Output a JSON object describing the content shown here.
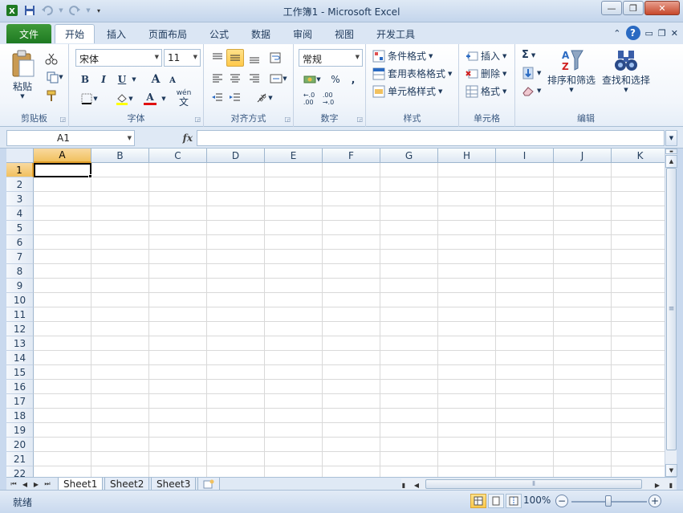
{
  "window": {
    "title": "工作簿1 - Microsoft Excel",
    "minimize": "—",
    "restore": "❐",
    "close": "✕"
  },
  "tabs": {
    "file": "文件",
    "items": [
      "开始",
      "插入",
      "页面布局",
      "公式",
      "数据",
      "审阅",
      "视图",
      "开发工具"
    ],
    "active_index": 0
  },
  "ribbon": {
    "clipboard": {
      "label": "剪贴板",
      "paste": "粘贴"
    },
    "font": {
      "label": "字体",
      "font_name": "宋体",
      "font_size": "11",
      "bold": "B",
      "italic": "I",
      "underline": "U",
      "grow": "A",
      "shrink": "A",
      "font_color": "A",
      "wen": "wén"
    },
    "alignment": {
      "label": "对齐方式"
    },
    "number": {
      "label": "数字",
      "format": "常规",
      "percent": "%",
      "comma": ","
    },
    "styles": {
      "label": "样式",
      "conditional": "条件格式",
      "table_format": "套用表格格式",
      "cell_styles": "单元格样式"
    },
    "cells": {
      "label": "单元格",
      "insert": "插入",
      "delete": "删除",
      "format": "格式"
    },
    "editing": {
      "label": "编辑",
      "sum": "Σ",
      "sort_filter": "排序和筛选",
      "find_select": "查找和选择"
    }
  },
  "formula_bar": {
    "name_box": "A1",
    "fx": "fx",
    "value": ""
  },
  "grid": {
    "columns": [
      "A",
      "B",
      "C",
      "D",
      "E",
      "F",
      "G",
      "H",
      "I",
      "J",
      "K"
    ],
    "rows": [
      "1",
      "2",
      "3",
      "4",
      "5",
      "6",
      "7",
      "8",
      "9",
      "10",
      "11",
      "12",
      "13",
      "14",
      "15",
      "16",
      "17",
      "18",
      "19",
      "20",
      "21",
      "22"
    ],
    "active_cell": "A1"
  },
  "sheets": {
    "tabs": [
      "Sheet1",
      "Sheet2",
      "Sheet3"
    ],
    "active_index": 0
  },
  "status": {
    "text": "就绪",
    "zoom": "100%",
    "zoom_minus": "−",
    "zoom_plus": "+"
  },
  "colors": {
    "file_tab": "#1e7a22",
    "selection_highlight": "#ffc94a",
    "header_active": "#f1c15f"
  }
}
